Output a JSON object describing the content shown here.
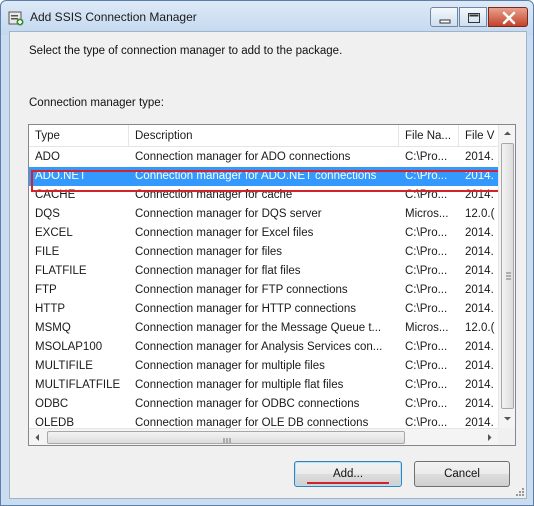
{
  "window": {
    "title": "Add SSIS Connection Manager"
  },
  "dialog": {
    "instruction": "Select the type of connection manager to add to the package.",
    "list_label": "Connection manager type:"
  },
  "columns": [
    "Type",
    "Description",
    "File Na...",
    "File V"
  ],
  "rows": [
    {
      "type": "ADO",
      "description": "Connection manager for ADO connections",
      "file": "C:\\Pro...",
      "version": "2014."
    },
    {
      "type": "ADO.NET",
      "description": "Connection manager for ADO.NET connections",
      "file": "C:\\Pro...",
      "version": "2014."
    },
    {
      "type": "CACHE",
      "description": "Connection manager for cache",
      "file": "C:\\Pro...",
      "version": "2014."
    },
    {
      "type": "DQS",
      "description": "Connection manager for DQS server",
      "file": "Micros...",
      "version": "12.0.("
    },
    {
      "type": "EXCEL",
      "description": "Connection manager for Excel files",
      "file": "C:\\Pro...",
      "version": "2014."
    },
    {
      "type": "FILE",
      "description": "Connection manager for files",
      "file": "C:\\Pro...",
      "version": "2014."
    },
    {
      "type": "FLATFILE",
      "description": "Connection manager for flat files",
      "file": "C:\\Pro...",
      "version": "2014."
    },
    {
      "type": "FTP",
      "description": "Connection manager for FTP connections",
      "file": "C:\\Pro...",
      "version": "2014."
    },
    {
      "type": "HTTP",
      "description": "Connection manager for HTTP connections",
      "file": "C:\\Pro...",
      "version": "2014."
    },
    {
      "type": "MSMQ",
      "description": "Connection manager for the Message Queue t...",
      "file": "Micros...",
      "version": "12.0.("
    },
    {
      "type": "MSOLAP100",
      "description": "Connection manager for Analysis Services con...",
      "file": "C:\\Pro...",
      "version": "2014."
    },
    {
      "type": "MULTIFILE",
      "description": "Connection manager for multiple files",
      "file": "C:\\Pro...",
      "version": "2014."
    },
    {
      "type": "MULTIFLATFILE",
      "description": "Connection manager for multiple flat files",
      "file": "C:\\Pro...",
      "version": "2014."
    },
    {
      "type": "ODBC",
      "description": "Connection manager for ODBC connections",
      "file": "C:\\Pro...",
      "version": "2014."
    },
    {
      "type": "OLEDB",
      "description": "Connection manager for OLE DB connections",
      "file": "C:\\Pro...",
      "version": "2014."
    }
  ],
  "selected_index": 1,
  "buttons": {
    "add": "Add...",
    "cancel": "Cancel"
  },
  "colors": {
    "selection": "#3399ff",
    "highlight_annotation": "#d2232a"
  },
  "icons": [
    "app-icon",
    "minimize-icon",
    "maximize-icon",
    "close-icon",
    "scroll-up-icon",
    "scroll-down-icon",
    "scroll-left-icon",
    "scroll-right-icon",
    "size-grip-icon"
  ]
}
